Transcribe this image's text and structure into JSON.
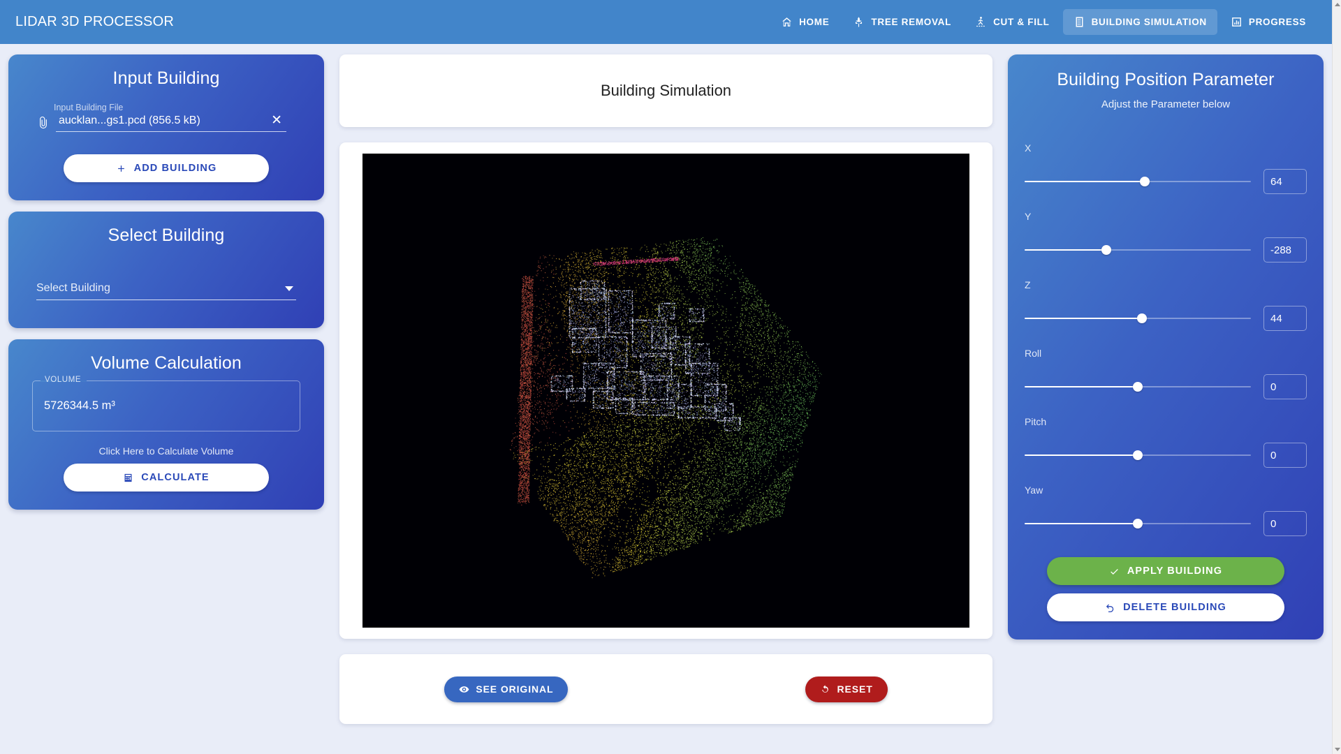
{
  "header": {
    "brand": "LIDAR 3D PROCESSOR",
    "nav": [
      {
        "label": "HOME",
        "icon": "home-icon",
        "active": false
      },
      {
        "label": "TREE REMOVAL",
        "icon": "tree-icon",
        "active": false
      },
      {
        "label": "CUT & FILL",
        "icon": "cut-fill-icon",
        "active": false
      },
      {
        "label": "BUILDING SIMULATION",
        "icon": "building-icon",
        "active": true
      },
      {
        "label": "PROGRESS",
        "icon": "chart-icon",
        "active": false
      }
    ]
  },
  "input_building": {
    "title": "Input Building",
    "file_label": "Input Building File",
    "file_name": "aucklan...gs1.pcd (856.5 kB)",
    "clear_icon": "close-icon",
    "attach_icon": "paperclip-icon",
    "add_button": "ADD BUILDING",
    "add_button_icon": "plus-icon"
  },
  "select_building": {
    "title": "Select Building",
    "placeholder": "Select Building",
    "selected_value": "Select Building",
    "caret_icon": "chevron-down-icon",
    "options": []
  },
  "volume_calculation": {
    "title": "Volume Calculation",
    "legend": "VOLUME",
    "value": "5726344.5 m³",
    "hint": "Click Here to Calculate Volume",
    "calculate_button": "CALCULATE",
    "calculate_icon": "calculator-icon"
  },
  "simulation": {
    "title": "Building Simulation",
    "see_original_button": "SEE ORIGINAL",
    "see_original_icon": "eye-icon",
    "reset_button": "RESET",
    "reset_icon": "refresh-icon"
  },
  "parameters": {
    "title": "Building Position Parameter",
    "subtitle": "Adjust the Parameter below",
    "sliders": [
      {
        "label": "X",
        "value": "64",
        "percent": 53
      },
      {
        "label": "Y",
        "value": "-288",
        "percent": 36
      },
      {
        "label": "Z",
        "value": "44",
        "percent": 52
      },
      {
        "label": "Roll",
        "value": "0",
        "percent": 50
      },
      {
        "label": "Pitch",
        "value": "0",
        "percent": 50
      },
      {
        "label": "Yaw",
        "value": "0",
        "percent": 50
      }
    ],
    "apply_button": "APPLY BUILDING",
    "apply_icon": "check-icon",
    "delete_button": "DELETE BUILDING",
    "delete_icon": "undo-icon"
  },
  "colors": {
    "header_blue": "#4285ca",
    "page_background": "#e9edf8",
    "card_gradient_start": "#4887cc",
    "card_gradient_end": "#3040b5",
    "accent_button_text": "#2a49b8",
    "apply_green": "#6cb24a",
    "reset_red": "#b01c1c",
    "see_original_blue": "#3767c0",
    "viewer_background": "#000005"
  },
  "viewer": {
    "description": "3D LiDAR point cloud of terrain colored by elevation with highlighted light-blue building footprints",
    "terrain_colors": [
      "#b05050",
      "#d8c840",
      "#8fc850",
      "#6fb060"
    ],
    "building_color": "#aab4f0"
  }
}
